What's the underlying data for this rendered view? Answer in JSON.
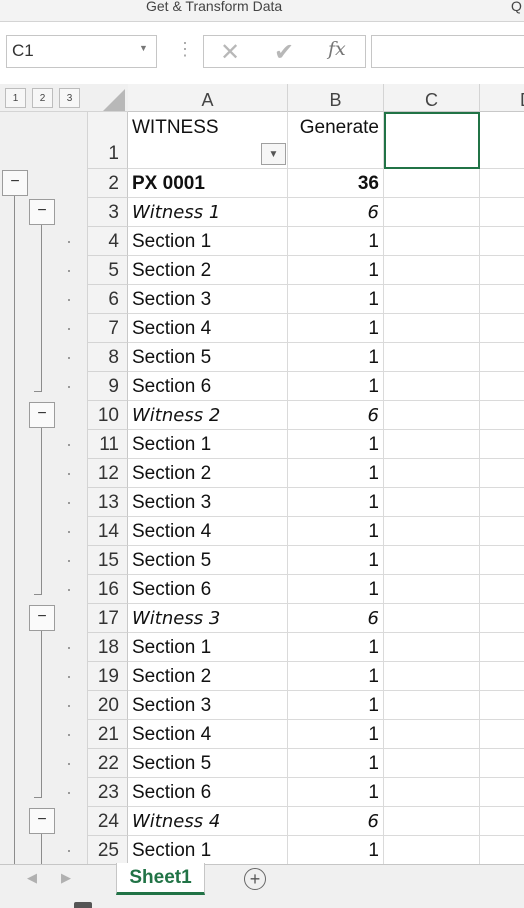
{
  "ribbon": {
    "group_label": "Get & Transform Data",
    "right_fragment": "Q"
  },
  "formula_bar": {
    "name_box": "C1",
    "fx_label": "fx",
    "cancel_glyph": "✕",
    "enter_glyph": "✔",
    "formula": ""
  },
  "outline_levels": [
    "1",
    "2",
    "3"
  ],
  "columns": [
    "A",
    "B",
    "C",
    "D"
  ],
  "header_row": {
    "row": "1",
    "a": "WITNESS",
    "b": "Generate"
  },
  "rows": [
    {
      "row": "2",
      "a": "PX 0001",
      "b": "36",
      "style": "bold"
    },
    {
      "row": "3",
      "a": "Witness 1",
      "b": "6",
      "style": "italic"
    },
    {
      "row": "4",
      "a": "Section 1",
      "b": "1",
      "style": "normal"
    },
    {
      "row": "5",
      "a": "Section 2",
      "b": "1",
      "style": "normal"
    },
    {
      "row": "6",
      "a": "Section 3",
      "b": "1",
      "style": "normal"
    },
    {
      "row": "7",
      "a": "Section 4",
      "b": "1",
      "style": "normal"
    },
    {
      "row": "8",
      "a": "Section 5",
      "b": "1",
      "style": "normal"
    },
    {
      "row": "9",
      "a": "Section 6",
      "b": "1",
      "style": "normal"
    },
    {
      "row": "10",
      "a": "Witness 2",
      "b": "6",
      "style": "italic"
    },
    {
      "row": "11",
      "a": "Section 1",
      "b": "1",
      "style": "normal"
    },
    {
      "row": "12",
      "a": "Section 2",
      "b": "1",
      "style": "normal"
    },
    {
      "row": "13",
      "a": "Section 3",
      "b": "1",
      "style": "normal"
    },
    {
      "row": "14",
      "a": "Section 4",
      "b": "1",
      "style": "normal"
    },
    {
      "row": "15",
      "a": "Section 5",
      "b": "1",
      "style": "normal"
    },
    {
      "row": "16",
      "a": "Section 6",
      "b": "1",
      "style": "normal"
    },
    {
      "row": "17",
      "a": "Witness 3",
      "b": "6",
      "style": "italic"
    },
    {
      "row": "18",
      "a": "Section 1",
      "b": "1",
      "style": "normal"
    },
    {
      "row": "19",
      "a": "Section 2",
      "b": "1",
      "style": "normal"
    },
    {
      "row": "20",
      "a": "Section 3",
      "b": "1",
      "style": "normal"
    },
    {
      "row": "21",
      "a": "Section 4",
      "b": "1",
      "style": "normal"
    },
    {
      "row": "22",
      "a": "Section 5",
      "b": "1",
      "style": "normal"
    },
    {
      "row": "23",
      "a": "Section 6",
      "b": "1",
      "style": "normal"
    },
    {
      "row": "24",
      "a": "Witness 4",
      "b": "6",
      "style": "italic"
    },
    {
      "row": "25",
      "a": "Section 1",
      "b": "1",
      "style": "normal"
    }
  ],
  "outline": {
    "collapse_glyph": "−"
  },
  "sheet_tabs": {
    "active": "Sheet1",
    "add_glyph": "+"
  },
  "colors": {
    "accent": "#217346",
    "grid": "#dadada",
    "header_bg": "#f3f3f3"
  }
}
